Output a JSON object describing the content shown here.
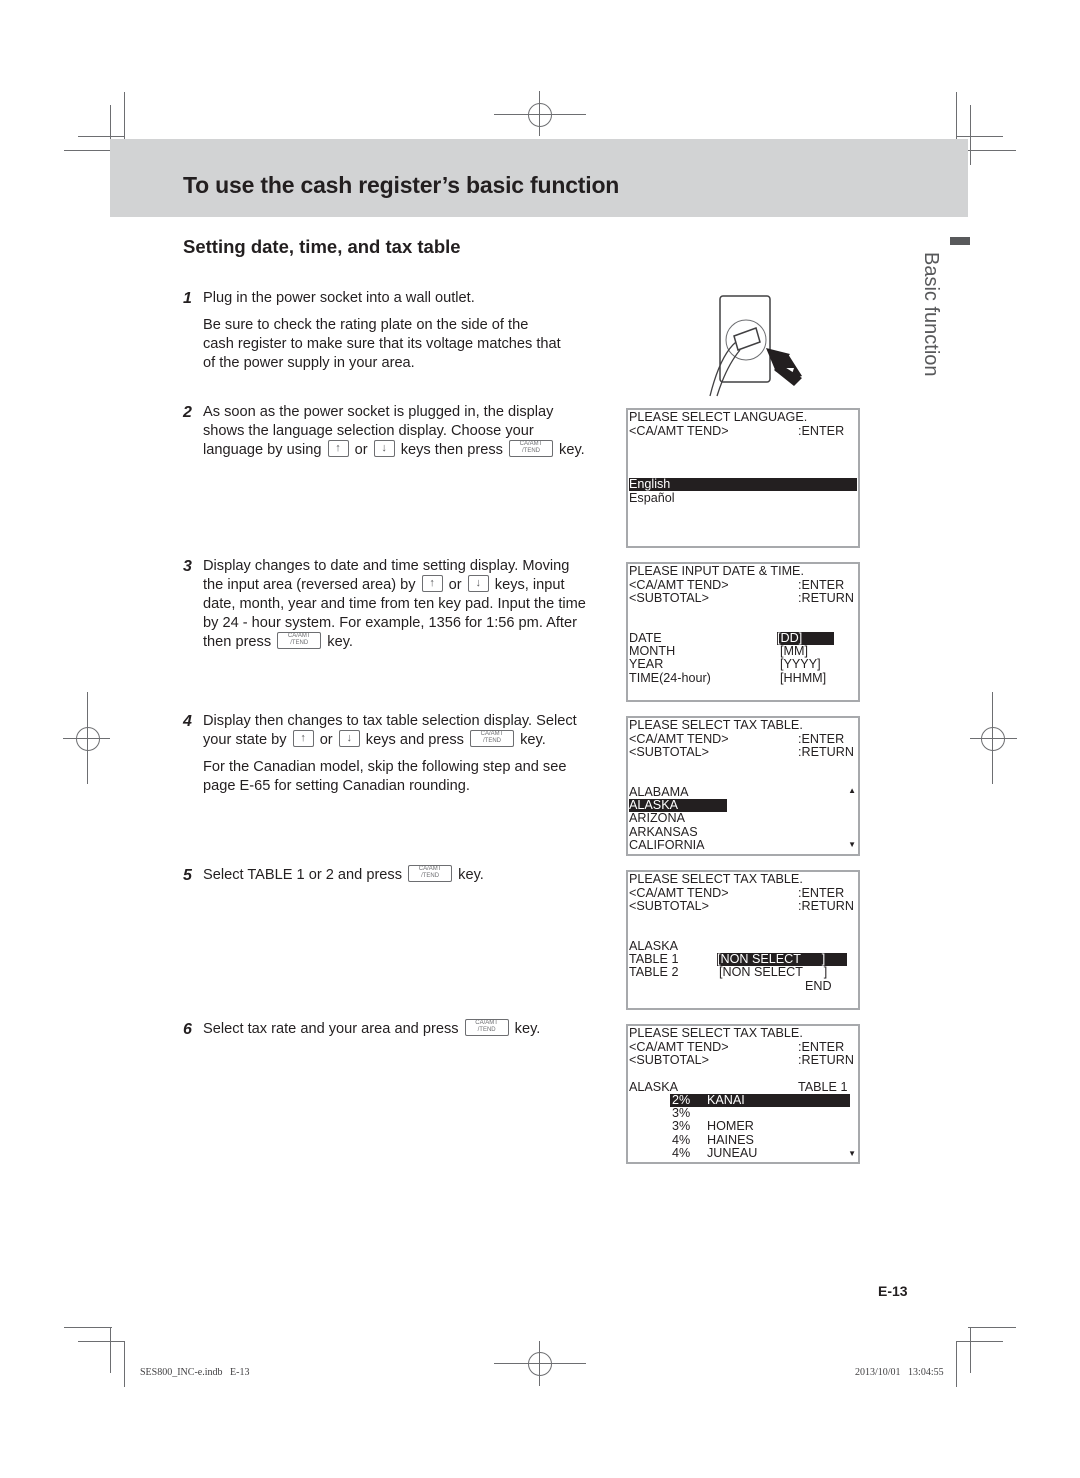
{
  "header": {
    "title": "To use the cash register’s basic function",
    "section_title": "Setting date, time, and tax table",
    "side_tab": "Basic function"
  },
  "keys": {
    "up_arrow": "↑",
    "down_arrow": "↓",
    "ca_top": "CA/AMT",
    "ca_bottom": "/TEND"
  },
  "steps": [
    {
      "num": "1",
      "text": "Plug in the power socket into a wall outlet.",
      "note": "Be sure to check the rating plate on the side of the cash register to make sure that its voltage matches that of the power supply in your area."
    },
    {
      "num": "2",
      "text_a": "As soon as the power socket is plugged in, the display shows the language selection display. Choose your language by using",
      "text_b": "or",
      "text_c": "keys then press",
      "text_d": "key."
    },
    {
      "num": "3",
      "text_a": "Display changes to date and time setting display. Mov­ing the input area (reversed area) by",
      "text_b": "or",
      "text_c": "keys, input date, month, year and time from ten key pad. Input the time by 24 - hour system. For example, 1356 for 1:56 pm. After then press",
      "text_d": "key."
    },
    {
      "num": "4",
      "text_a": "Display then changes to tax table selection display. Select your state by",
      "text_b": "or",
      "text_c": "keys and press",
      "text_d": "key.",
      "note": "For the Canadian model, skip the following step and see page E-65 for setting Canadian rounding."
    },
    {
      "num": "5",
      "text_a": "Select TABLE 1 or 2 and press",
      "text_d": "key."
    },
    {
      "num": "6",
      "text_a": "Select tax rate and your area and press",
      "text_d": "key."
    }
  ],
  "screens": {
    "language": {
      "title": "PLEASE SELECT LANGUAGE.",
      "enter_key": "<CA/AMT TEND>",
      "enter_label": ":ENTER",
      "options": [
        "English",
        "Español"
      ],
      "selected": "English"
    },
    "date_time": {
      "title": "PLEASE INPUT DATE & TIME.",
      "enter_key": "<CA/AMT TEND>",
      "enter_label": ":ENTER",
      "return_key": "<SUBTOTAL>",
      "return_label": ":RETURN",
      "fields": [
        {
          "label": "DATE",
          "value": "[DD]"
        },
        {
          "label": "MONTH",
          "value": "[MM]"
        },
        {
          "label": "YEAR",
          "value": "[YYYY]"
        },
        {
          "label": "TIME(24-hour)",
          "value": "[HHMM]"
        }
      ],
      "selected": "DATE"
    },
    "tax_state": {
      "title": "PLEASE SELECT TAX TABLE.",
      "enter_key": "<CA/AMT TEND>",
      "enter_label": ":ENTER",
      "return_key": "<SUBTOTAL>",
      "return_label": ":RETURN",
      "states": [
        "ALABAMA",
        "ALASKA",
        "ARIZONA",
        "ARKANSAS",
        "CALIFORNIA"
      ],
      "selected": "ALASKA",
      "scroll_up": "▲",
      "scroll_down": "▼"
    },
    "tax_table": {
      "title": "PLEASE SELECT TAX TABLE.",
      "enter_key": "<CA/AMT TEND>",
      "enter_label": ":ENTER",
      "return_key": "<SUBTOTAL>",
      "return_label": ":RETURN",
      "state": "ALASKA",
      "tables": [
        {
          "label": "TABLE 1",
          "value": "[NON SELECT      ]"
        },
        {
          "label": "TABLE 2",
          "value": "[NON SELECT      ]"
        }
      ],
      "selected": "TABLE 1",
      "end_label": "END"
    },
    "tax_rate": {
      "title": "PLEASE SELECT TAX TABLE.",
      "enter_key": "<CA/AMT TEND>",
      "enter_label": ":ENTER",
      "return_key": "<SUBTOTAL>",
      "return_label": ":RETURN",
      "state": "ALASKA",
      "table": "TABLE 1",
      "rates": [
        {
          "rate": "2%",
          "area": "KANAI"
        },
        {
          "rate": "3%",
          "area": ""
        },
        {
          "rate": "3%",
          "area": "HOMER"
        },
        {
          "rate": "4%",
          "area": "HAINES"
        },
        {
          "rate": "4%",
          "area": "JUNEAU"
        }
      ],
      "selected": "KANAI",
      "scroll_down": "▼"
    }
  },
  "footer": {
    "page_number": "E-13",
    "file_info": "SES800_INC-e.indb   E-13",
    "timestamp": "2013/10/01   13:04:55"
  }
}
